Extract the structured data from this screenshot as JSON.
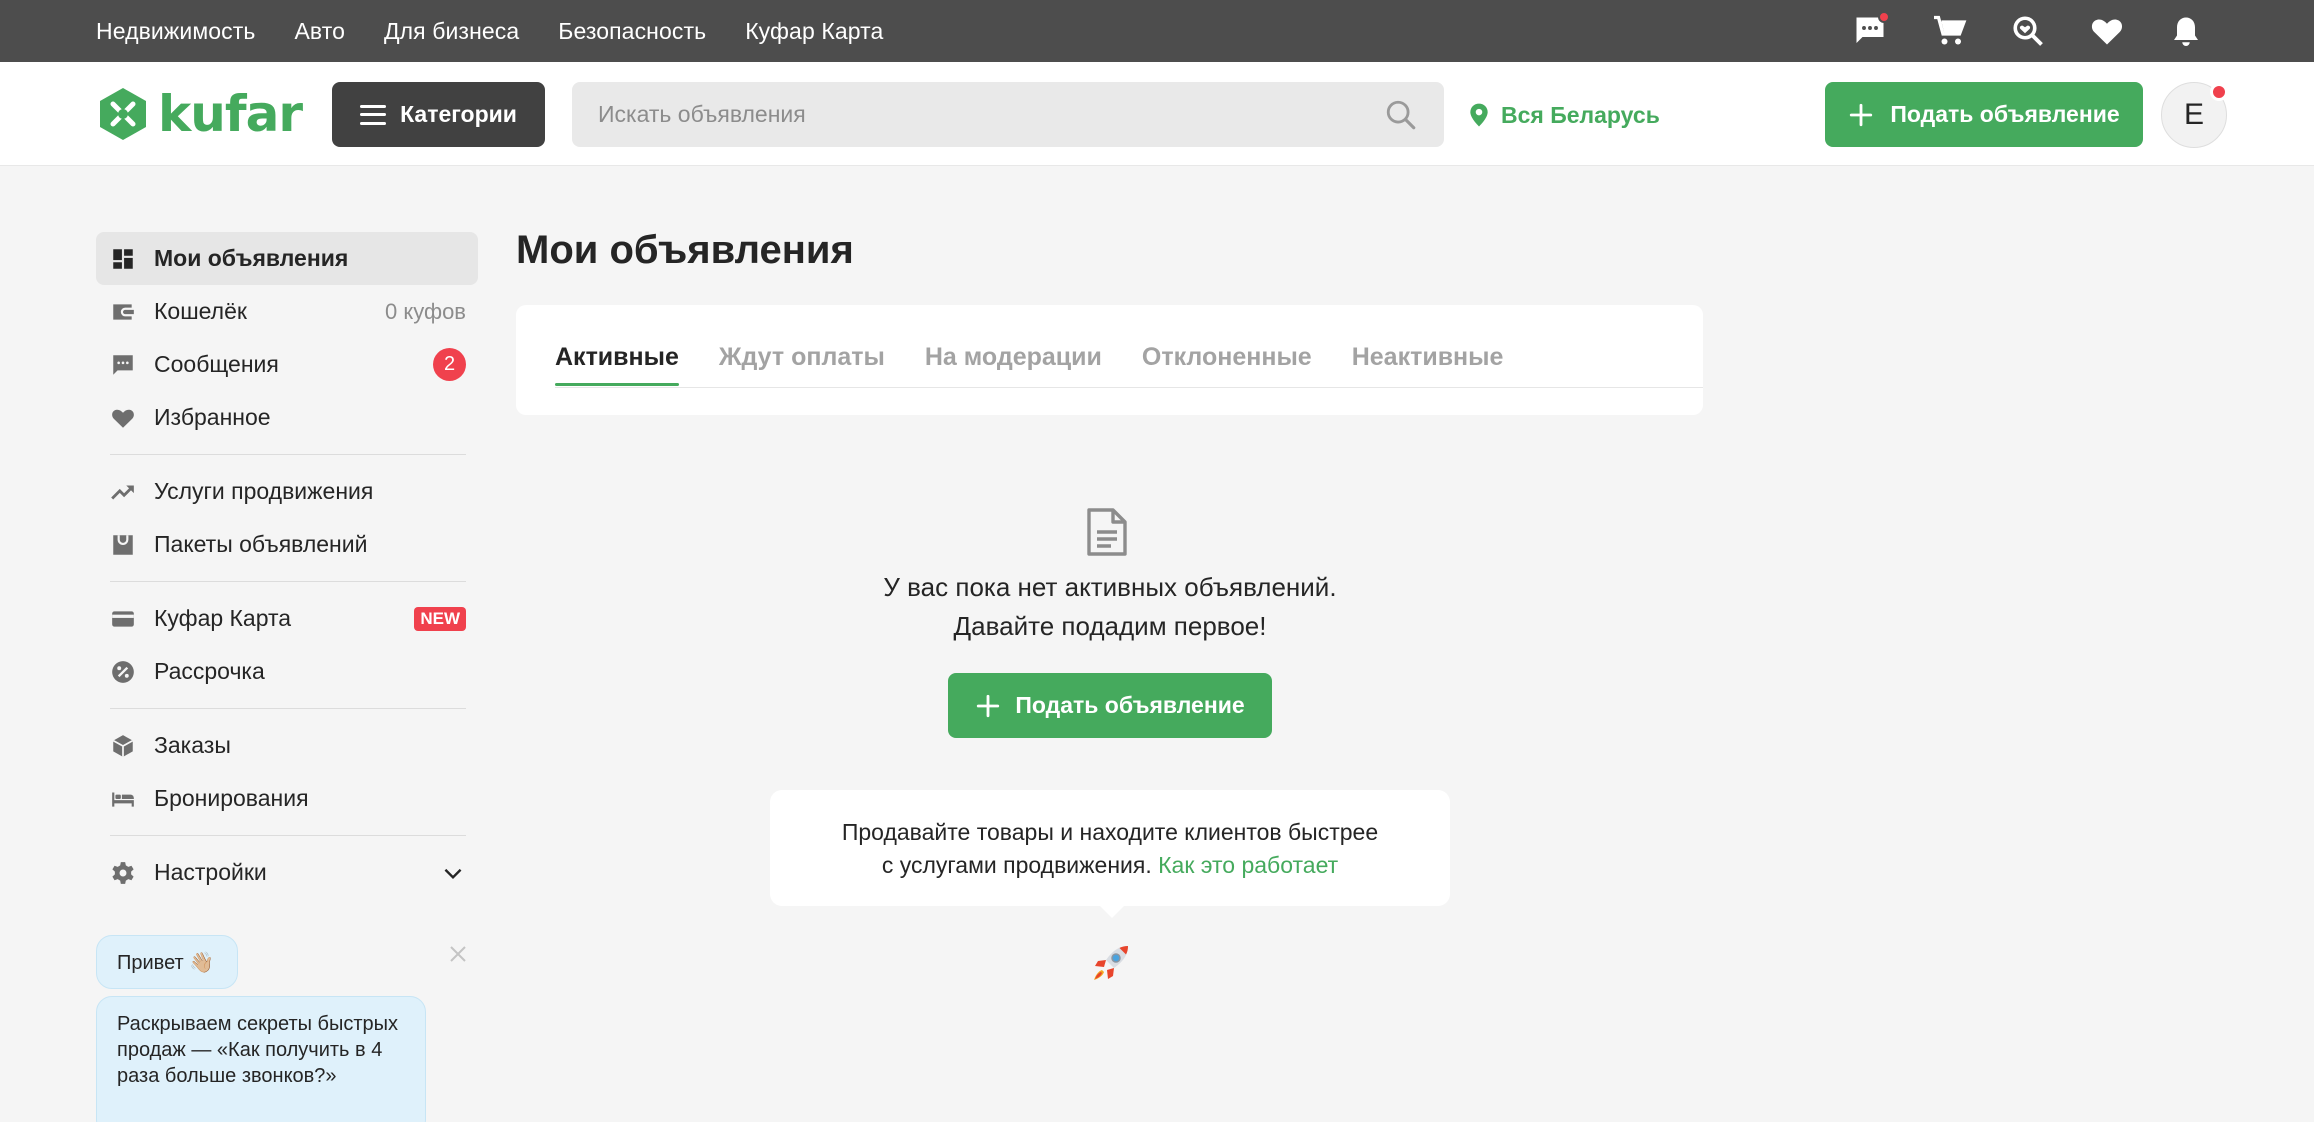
{
  "topbar": {
    "links": [
      "Недвижимость",
      "Авто",
      "Для бизнеса",
      "Безопасность",
      "Куфар Карта"
    ],
    "icons": [
      "chat-icon",
      "cart-icon",
      "saved-search-icon",
      "heart-icon",
      "bell-icon"
    ]
  },
  "header": {
    "logo_text": "kufar",
    "categories_label": "Категории",
    "search_placeholder": "Искать объявления",
    "region_label": "Вся Беларусь",
    "post_ad_label": "Подать объявление",
    "avatar_letter": "E"
  },
  "sidebar": {
    "items": [
      {
        "label": "Мои объявления",
        "icon": "dashboard-icon"
      },
      {
        "label": "Кошелёк",
        "value": "0 куфов",
        "icon": "wallet-icon"
      },
      {
        "label": "Сообщения",
        "badge": "2",
        "icon": "message-icon"
      },
      {
        "label": "Избранное",
        "icon": "heart-icon"
      },
      {
        "label": "Услуги продвижения",
        "icon": "trending-up-icon"
      },
      {
        "label": "Пакеты объявлений",
        "icon": "bag-icon"
      },
      {
        "label": "Куфар Карта",
        "badge": "NEW",
        "icon": "card-icon"
      },
      {
        "label": "Рассрочка",
        "icon": "percent-icon"
      },
      {
        "label": "Заказы",
        "icon": "box-icon"
      },
      {
        "label": "Бронирования",
        "icon": "bed-icon"
      },
      {
        "label": "Настройки",
        "icon": "gear-icon"
      }
    ]
  },
  "chat": {
    "hello": "Привет 👋🏼",
    "message": "Раскрываем секреты быстрых продаж — «Как получить в 4 раза больше звонков?»"
  },
  "main": {
    "title": "Мои объявления",
    "tabs": [
      "Активные",
      "Ждут оплаты",
      "На модерации",
      "Отклоненные",
      "Неактивные"
    ],
    "active_tab": "Активные",
    "empty_line1": "У вас пока нет активных объявлений.",
    "empty_line2": "Давайте подадим первое!",
    "post_ad_label": "Подать объявление",
    "promo_line1": "Продавайте товары и находите клиентов быстрее",
    "promo_line2": "с услугами продвижения.",
    "promo_link": "Как это работает"
  },
  "colors": {
    "brand_green": "#45aa5d",
    "dark_bar": "#4d4d4d",
    "badge_red": "#f0414d"
  }
}
